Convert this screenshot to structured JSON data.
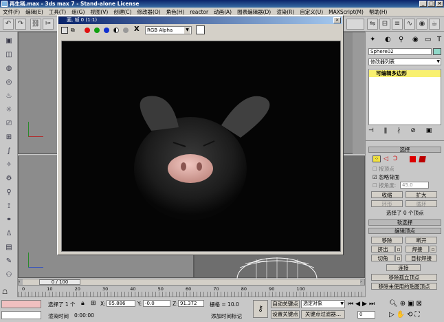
{
  "window": {
    "title": "再生猪.max - 3ds max 7 - Stand-alone License"
  },
  "menu": [
    "文件(F)",
    "编辑(E)",
    "工具(T)",
    "组(G)",
    "视图(V)",
    "创建(C)",
    "修改器(O)",
    "角色(H)",
    "reactor",
    "动画(A)",
    "图表编辑器(D)",
    "渲染(R)",
    "自定义(U)",
    "MAXScript(M)",
    "帮助(H)"
  ],
  "render_frame": {
    "title": "面, 帧 0 (1:1)",
    "channel": "RGB Alpha",
    "channel_x": "X"
  },
  "command_panel": {
    "object_name": "Sphere02",
    "modifier_list": "修改器列表",
    "stack_item": "可编辑多边形",
    "selection": {
      "title": "选择",
      "by_vertex": "按顶点",
      "ignore_backfacing": "忽略背面",
      "by_angle": "按角度:",
      "angle_value": "45.0",
      "shrink": "收缩",
      "grow": "扩大",
      "ring": "环形",
      "loop": "循环",
      "status": "选择了 0 个顶点"
    },
    "soft_selection": "软选择",
    "edit_vertices": {
      "title": "编辑顶点",
      "remove": "移除",
      "break": "断开",
      "extrude": "挤出",
      "weld": "焊接",
      "chamfer": "切角",
      "target_weld": "目标焊接",
      "connect": "连接",
      "remove_isolated": "移除孤立顶点",
      "remove_unused_map": "移除未使用的贴图顶点"
    }
  },
  "timeline": {
    "position": "0 / 100",
    "ticks": [
      "0",
      "10",
      "20",
      "30",
      "40",
      "50",
      "60",
      "70",
      "80",
      "90",
      "100"
    ]
  },
  "status": {
    "selected": "选择了 1 个",
    "x_label": "X:",
    "x": "85.886",
    "y_label": "Y:",
    "y": "-0.0",
    "z_label": "Z:",
    "z": "91.372",
    "grid": "栅格 = 10.0",
    "auto_key": "自动关键点",
    "selected_obj": "选定对象",
    "set_key": "设置关键点",
    "key_filters": "关键点过滤器...",
    "render_time_label": "渲染时间",
    "render_time": "0:00:00",
    "add_time_tag": "添加时间标记",
    "frame_field": "0"
  }
}
